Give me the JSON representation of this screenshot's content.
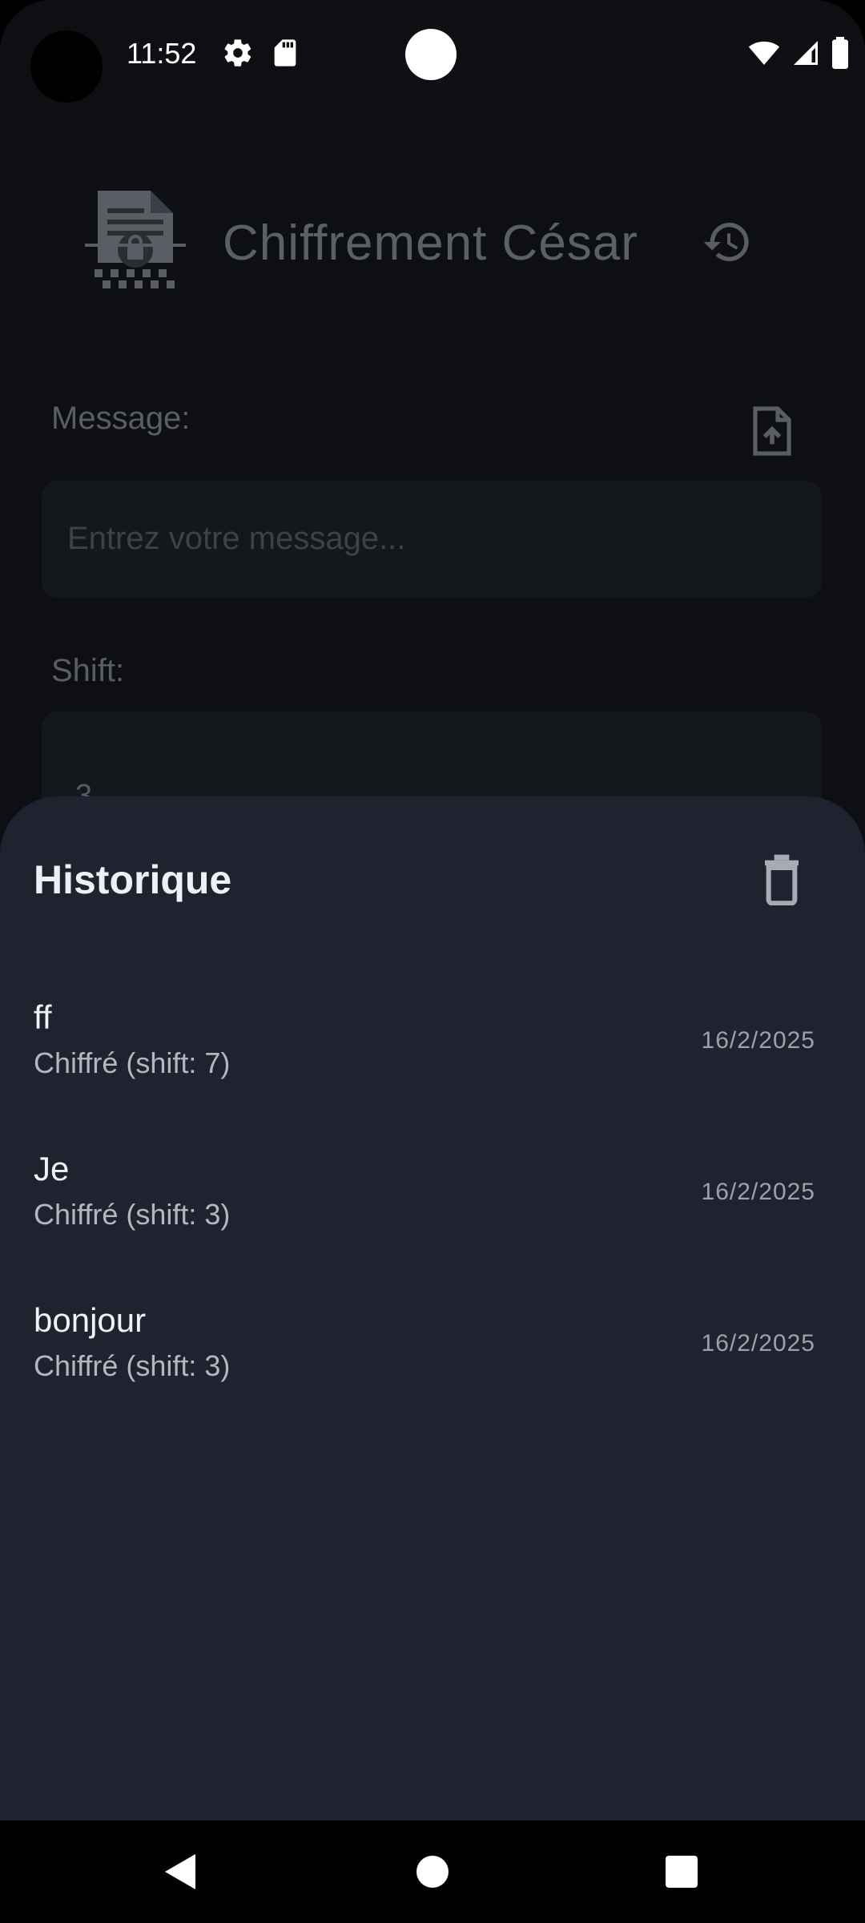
{
  "status_bar": {
    "time": "11:52",
    "icons": [
      "settings-gear-icon",
      "sd-card-icon",
      "wifi-icon",
      "cellular-signal-icon",
      "battery-icon"
    ]
  },
  "app": {
    "title": "Chiffrement César",
    "logo_icon": "encrypted-document-icon",
    "history_icon": "history-icon",
    "message": {
      "label": "Message:",
      "placeholder": "Entrez votre message...",
      "upload_icon": "file-upload-icon"
    },
    "shift": {
      "label": "Shift:",
      "value": "3"
    }
  },
  "history_sheet": {
    "title": "Historique",
    "delete_icon": "trash-icon",
    "items": [
      {
        "text": "ff",
        "detail": "Chiffré (shift: 7)",
        "date": "16/2/2025"
      },
      {
        "text": "Je",
        "detail": "Chiffré (shift: 3)",
        "date": "16/2/2025"
      },
      {
        "text": "bonjour",
        "detail": "Chiffré (shift: 3)",
        "date": "16/2/2025"
      }
    ]
  },
  "colors": {
    "background": "#0d0f13",
    "sheet": "#1f2330",
    "text_primary": "#f1f2f5",
    "text_secondary": "#b3b7c0"
  }
}
